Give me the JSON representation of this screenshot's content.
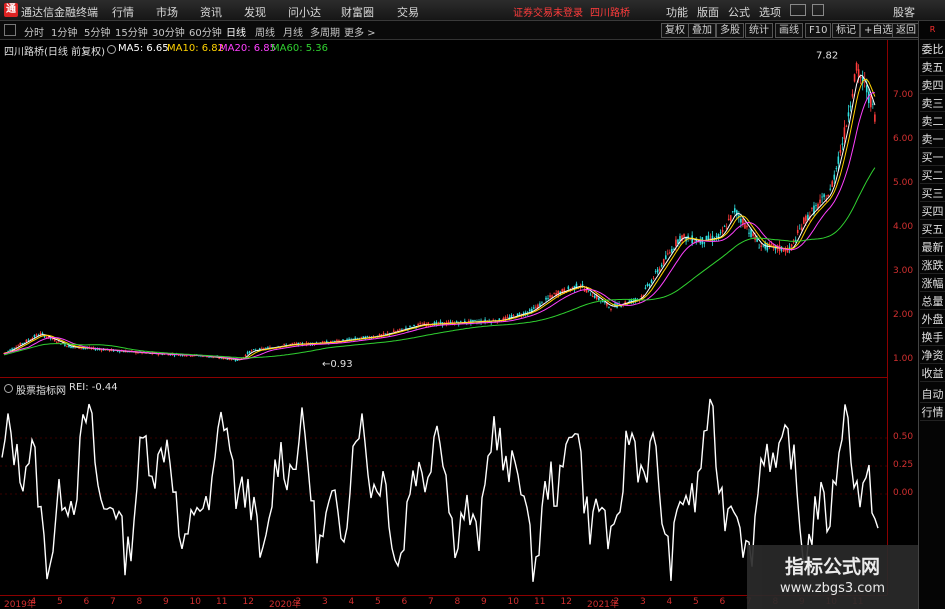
{
  "app": {
    "logo": "通",
    "name": "通达信金融终端"
  },
  "menu": [
    "行情",
    "市场",
    "资讯",
    "发现",
    "问小达",
    "财富圈",
    "交易"
  ],
  "notice": {
    "login": "证券交易未登录",
    "stock": "四川路桥"
  },
  "right_menu": [
    "功能",
    "版面",
    "公式",
    "选项"
  ],
  "search_label": "股客",
  "periods": [
    "分时",
    "1分钟",
    "5分钟",
    "15分钟",
    "30分钟",
    "60分钟",
    "日线",
    "周线",
    "月线",
    "多周期",
    "更多 >"
  ],
  "active_period": "日线",
  "toolbar_buttons": [
    "复权",
    "叠加",
    "多股",
    "统计",
    "画线",
    "F10",
    "标记",
    "+自选",
    "返回"
  ],
  "side_panel": [
    "委比",
    "卖五",
    "卖四",
    "卖三",
    "卖二",
    "卖一",
    "买一",
    "买二",
    "买三",
    "买四",
    "买五",
    "最新",
    "涨跌",
    "涨幅",
    "总量",
    "外盘",
    "换手",
    "净资",
    "收益"
  ],
  "side_panel_sub": [
    "自动",
    "行情"
  ],
  "side_top_badge": "R",
  "main_legend": {
    "title": "四川路桥(日线 前复权)",
    "ma": [
      {
        "label": "MA5: 6.65",
        "color": "#ffffff"
      },
      {
        "label": "MA10: 6.82",
        "color": "#ffd200"
      },
      {
        "label": "MA20: 6.85",
        "color": "#ff40ff"
      },
      {
        "label": "MA60: 5.36",
        "color": "#30d030"
      }
    ]
  },
  "sub_legend": {
    "title": "股票指标网",
    "value": "REI: -0.44"
  },
  "price_axis": [
    "7.00",
    "6.00",
    "5.00",
    "4.00",
    "3.00",
    "2.00",
    "1.00"
  ],
  "sub_axis": [
    "0.50",
    "0.25",
    "0.00"
  ],
  "annotations": {
    "high": "7.82",
    "low": "0.93"
  },
  "date_axis": [
    "2019年",
    "4",
    "5",
    "6",
    "7",
    "8",
    "9",
    "10",
    "11",
    "12",
    "2020年",
    "2",
    "3",
    "4",
    "5",
    "6",
    "7",
    "8",
    "9",
    "10",
    "11",
    "12",
    "2021年",
    "2",
    "3",
    "4",
    "5",
    "6",
    "7",
    "8",
    "9",
    "10",
    "11"
  ],
  "watermark": {
    "title": "指标公式网",
    "url": "www.zbgs3.com"
  },
  "colors": {
    "up": "#ff3c3c",
    "down": "#30e0e0",
    "ma5": "#ffffff",
    "ma10": "#ffd200",
    "ma20": "#ff40ff",
    "ma60": "#30d030",
    "axis": "#d03030"
  }
}
